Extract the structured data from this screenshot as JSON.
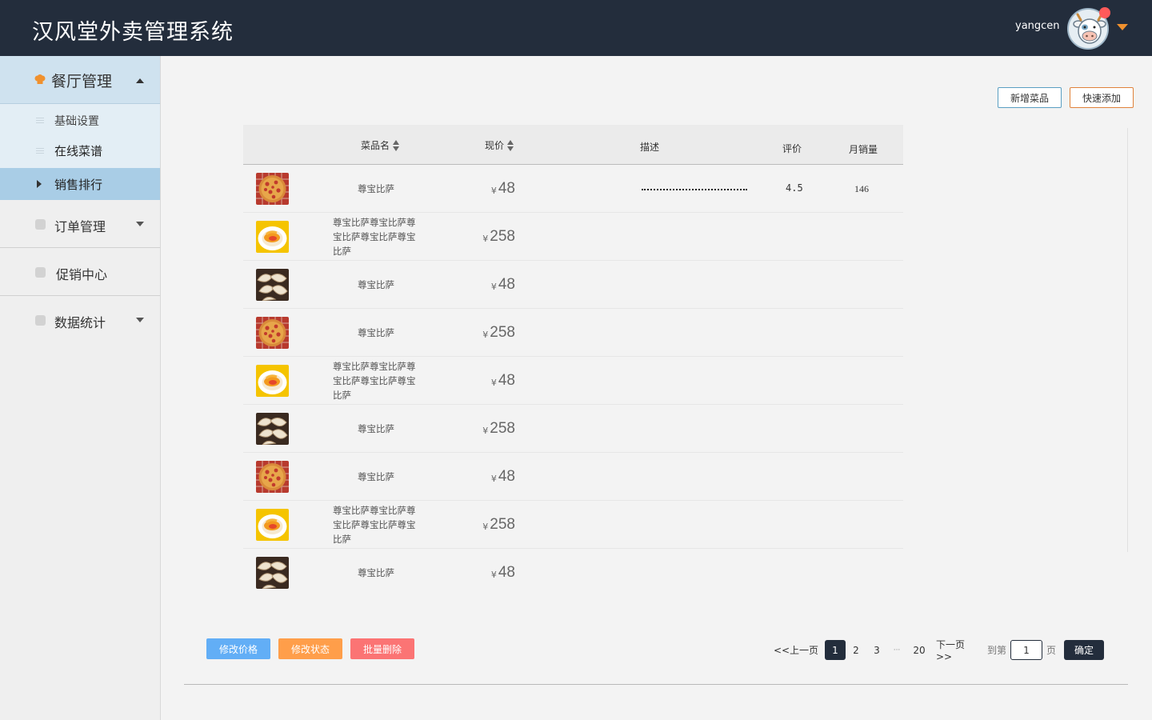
{
  "header": {
    "app_title": "汉风堂外卖管理系统",
    "username": "yangcen",
    "colors": {
      "bar": "#232d3c",
      "accent": "#f0912e",
      "notify": "#ff5a5a"
    }
  },
  "sidebar": {
    "groups": [
      {
        "label": "餐厅管理",
        "icon": "chef-hat-icon",
        "expanded": true,
        "items": [
          {
            "label": "基础设置",
            "icon": "menu-lines-icon"
          },
          {
            "label": "在线菜谱",
            "icon": "menu-lines-icon"
          },
          {
            "label": "销售排行",
            "icon": "caret-right-icon",
            "selected": true
          }
        ]
      },
      {
        "label": "订单管理",
        "icon": "square-icon"
      },
      {
        "label": "促销中心",
        "icon": "square-icon"
      },
      {
        "label": "数据统计",
        "icon": "square-icon"
      }
    ]
  },
  "toolbar": {
    "add_dish": "新增菜品",
    "quick_add": "快速添加"
  },
  "table": {
    "headers": {
      "name": "菜品名",
      "price": "现价",
      "desc": "描述",
      "rating": "评价",
      "sales": "月销量"
    },
    "currency": "¥",
    "rows": [
      {
        "image": "pizza",
        "name": "尊宝比萨",
        "price": "48",
        "rating": "4.5",
        "sales": "146"
      },
      {
        "image": "mango-plate",
        "name": "尊宝比萨尊宝比萨尊宝比萨尊宝比萨尊宝比萨",
        "price": "258"
      },
      {
        "image": "dumplings",
        "name": "尊宝比萨",
        "price": "48"
      },
      {
        "image": "pizza",
        "name": "尊宝比萨",
        "price": "258"
      },
      {
        "image": "mango-plate",
        "name": "尊宝比萨尊宝比萨尊宝比萨尊宝比萨尊宝比萨",
        "price": "48"
      },
      {
        "image": "dumplings",
        "name": "尊宝比萨",
        "price": "258"
      },
      {
        "image": "pizza",
        "name": "尊宝比萨",
        "price": "48"
      },
      {
        "image": "mango-plate",
        "name": "尊宝比萨尊宝比萨尊宝比萨尊宝比萨尊宝比萨",
        "price": "258"
      },
      {
        "image": "dumplings",
        "name": "尊宝比萨",
        "price": "48"
      }
    ]
  },
  "actions": {
    "edit_price": "修改价格",
    "edit_status": "修改状态",
    "batch_delete": "批量删除"
  },
  "pagination": {
    "prev": "<<上一页",
    "current": "1",
    "pages": [
      "2",
      "3"
    ],
    "ellipsis": "···",
    "last": "20",
    "next": "下一页>>",
    "goto_label": "到第",
    "goto_value": "1",
    "page_unit": "页",
    "confirm": "确定"
  }
}
